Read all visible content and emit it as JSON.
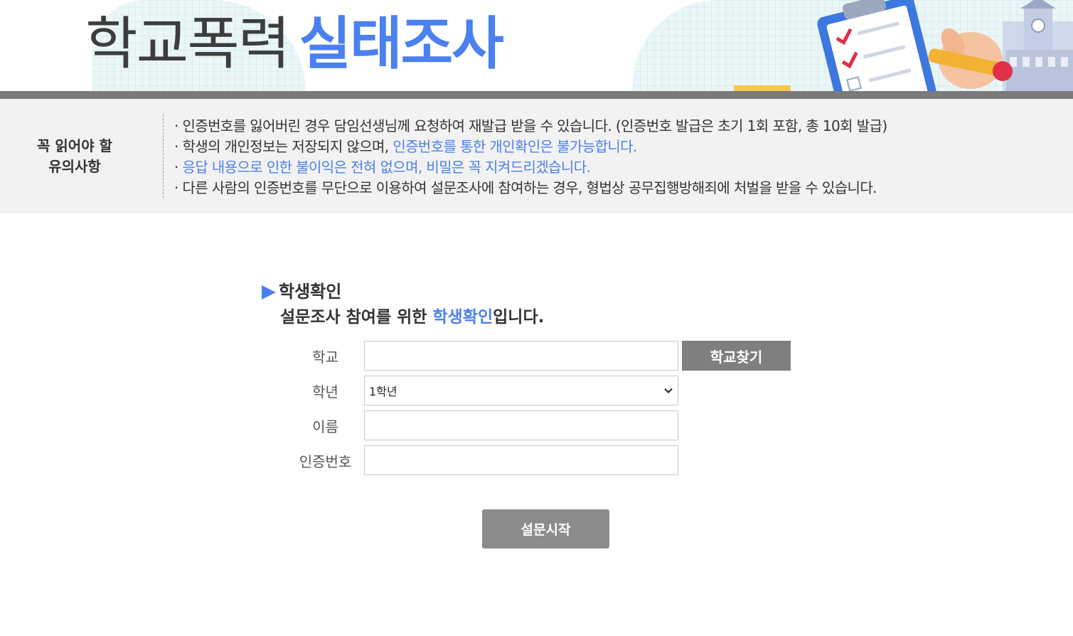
{
  "banner": {
    "title_part1": "학교폭력",
    "title_part2": "실태조사"
  },
  "notice": {
    "title_line1": "꼭 읽어야 할",
    "title_line2": "유의사항",
    "items": [
      {
        "text": "인증번호를 잃어버린 경우 담임선생님께 요청하여 재발급 받을 수 있습니다. (인증번호 발급은 초기 1회 포함, 총 10회 발급)"
      },
      {
        "text": "학생의 개인정보는 저장되지 않으며,",
        "highlight": "인증번호를 통한 개인확인은 불가능합니다."
      },
      {
        "highlight": "응답 내용으로 인한 불이익은 전혀 없으며, 비밀은 꼭 지켜드리겠습니다."
      },
      {
        "text": "다른 사람의 인증번호를 무단으로 이용하여 설문조사에 참여하는 경우, 형법상 공무집행방해죄에 처벌을 받을 수 있습니다."
      }
    ]
  },
  "form": {
    "section_title": "학생확인",
    "subtitle_pre": "설문조사 참여를 위한",
    "subtitle_highlight": "학생확인",
    "subtitle_post": "입니다.",
    "school_label": "학교",
    "school_value": "",
    "find_school_button": "학교찾기",
    "grade_label": "학년",
    "grade_selected": "1학년",
    "name_label": "이름",
    "name_value": "",
    "auth_label": "인증번호",
    "auth_value": "",
    "start_button": "설문시작"
  },
  "colors": {
    "accent": "#4a80f0",
    "button_gray": "#7f7f7f",
    "notice_bg": "#f2f2f2"
  }
}
